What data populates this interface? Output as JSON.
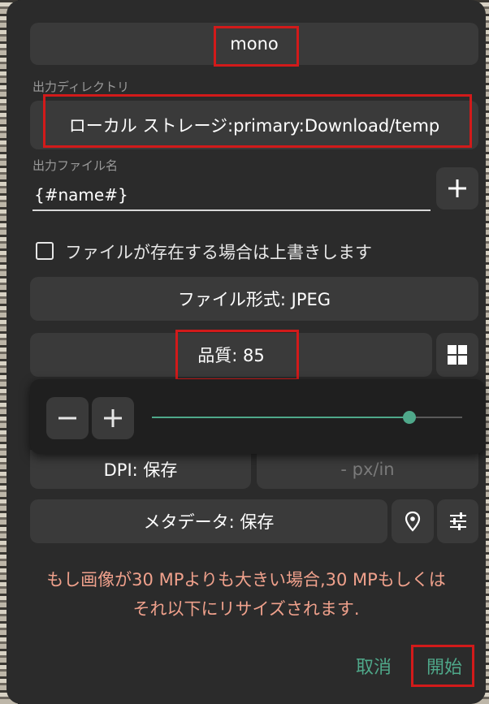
{
  "top_button": {
    "label": "mono"
  },
  "output_dir": {
    "label": "出力ディレクトリ",
    "value": "ローカル ストレージ:primary:Download/temp"
  },
  "output_filename": {
    "label": "出力ファイル名",
    "value": "{#name#}"
  },
  "overwrite": {
    "label": "ファイルが存在する場合は上書きします",
    "checked": false
  },
  "file_format": {
    "label": "ファイル形式: JPEG"
  },
  "quality": {
    "label": "品質: 85",
    "value": 85,
    "min": 0,
    "max": 100,
    "slider_fraction": 0.83
  },
  "dpi": {
    "label": "DPI: 保存",
    "value_placeholder": "- px/in"
  },
  "metadata": {
    "label": "メタデータ: 保存"
  },
  "warning": {
    "line1": "もし画像が30 MPよりも大きい場合,30 MPもしくは",
    "line2": "それ以下にリサイズされます."
  },
  "actions": {
    "cancel": "取消",
    "start": "開始"
  },
  "colors": {
    "accent": "#4fa88a",
    "warning": "#f0a18c",
    "highlight": "#d21a1a"
  }
}
